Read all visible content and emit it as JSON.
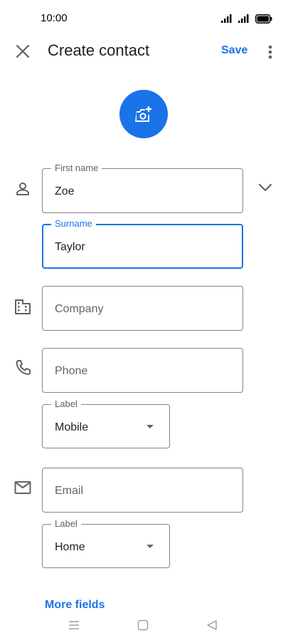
{
  "status_bar": {
    "time": "10:00"
  },
  "app_bar": {
    "title": "Create contact",
    "save_label": "Save",
    "close_icon": "close-icon",
    "more_icon": "more-vert-icon"
  },
  "photo": {
    "icon": "add-photo-icon",
    "color": "#1a73e8"
  },
  "name": {
    "first_name_label": "First name",
    "first_name_value": "Zoe",
    "surname_label": "Surname",
    "surname_value": "Taylor",
    "expand_icon": "chevron-down-icon"
  },
  "company": {
    "placeholder": "Company"
  },
  "phone": {
    "placeholder": "Phone",
    "label_caption": "Label",
    "label_value": "Mobile"
  },
  "email": {
    "placeholder": "Email",
    "label_caption": "Label",
    "label_value": "Home"
  },
  "more_fields_label": "More fields",
  "colors": {
    "accent": "#1a73e8",
    "outline": "#80868b",
    "secondary_text": "#5f6368"
  }
}
